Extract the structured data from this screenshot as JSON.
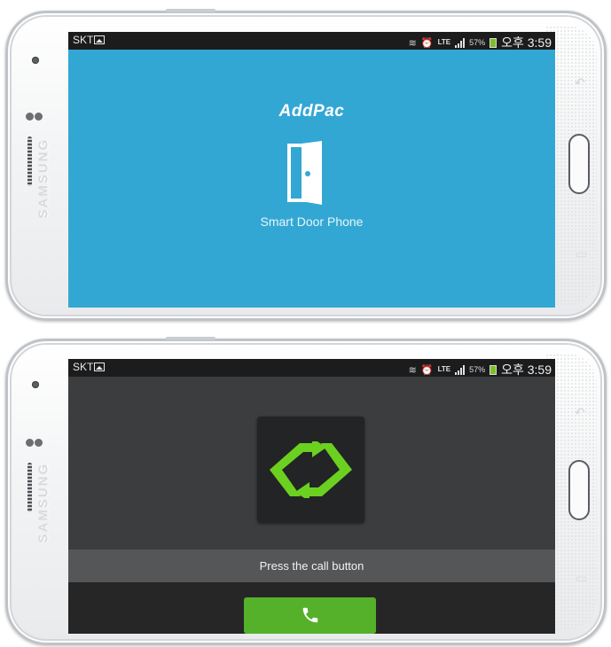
{
  "brand": {
    "name": "SAMSUNG"
  },
  "screens": [
    {
      "id": "splash",
      "status_bar": {
        "carrier": "SKT",
        "battery": "57%",
        "time": "오후 3:59",
        "network": "LTE"
      },
      "logo": "AddPac",
      "title": "Smart Door Phone",
      "icon": "door-icon",
      "background": "#33a7d3"
    },
    {
      "id": "call",
      "status_bar": {
        "carrier": "SKT",
        "battery": "57%",
        "time": "오후 3:59",
        "network": "LTE"
      },
      "icon": "sync-arrows-icon",
      "prompt": "Press the call button",
      "call_button_icon": "phone-icon",
      "accent": "#55b02a"
    }
  ]
}
